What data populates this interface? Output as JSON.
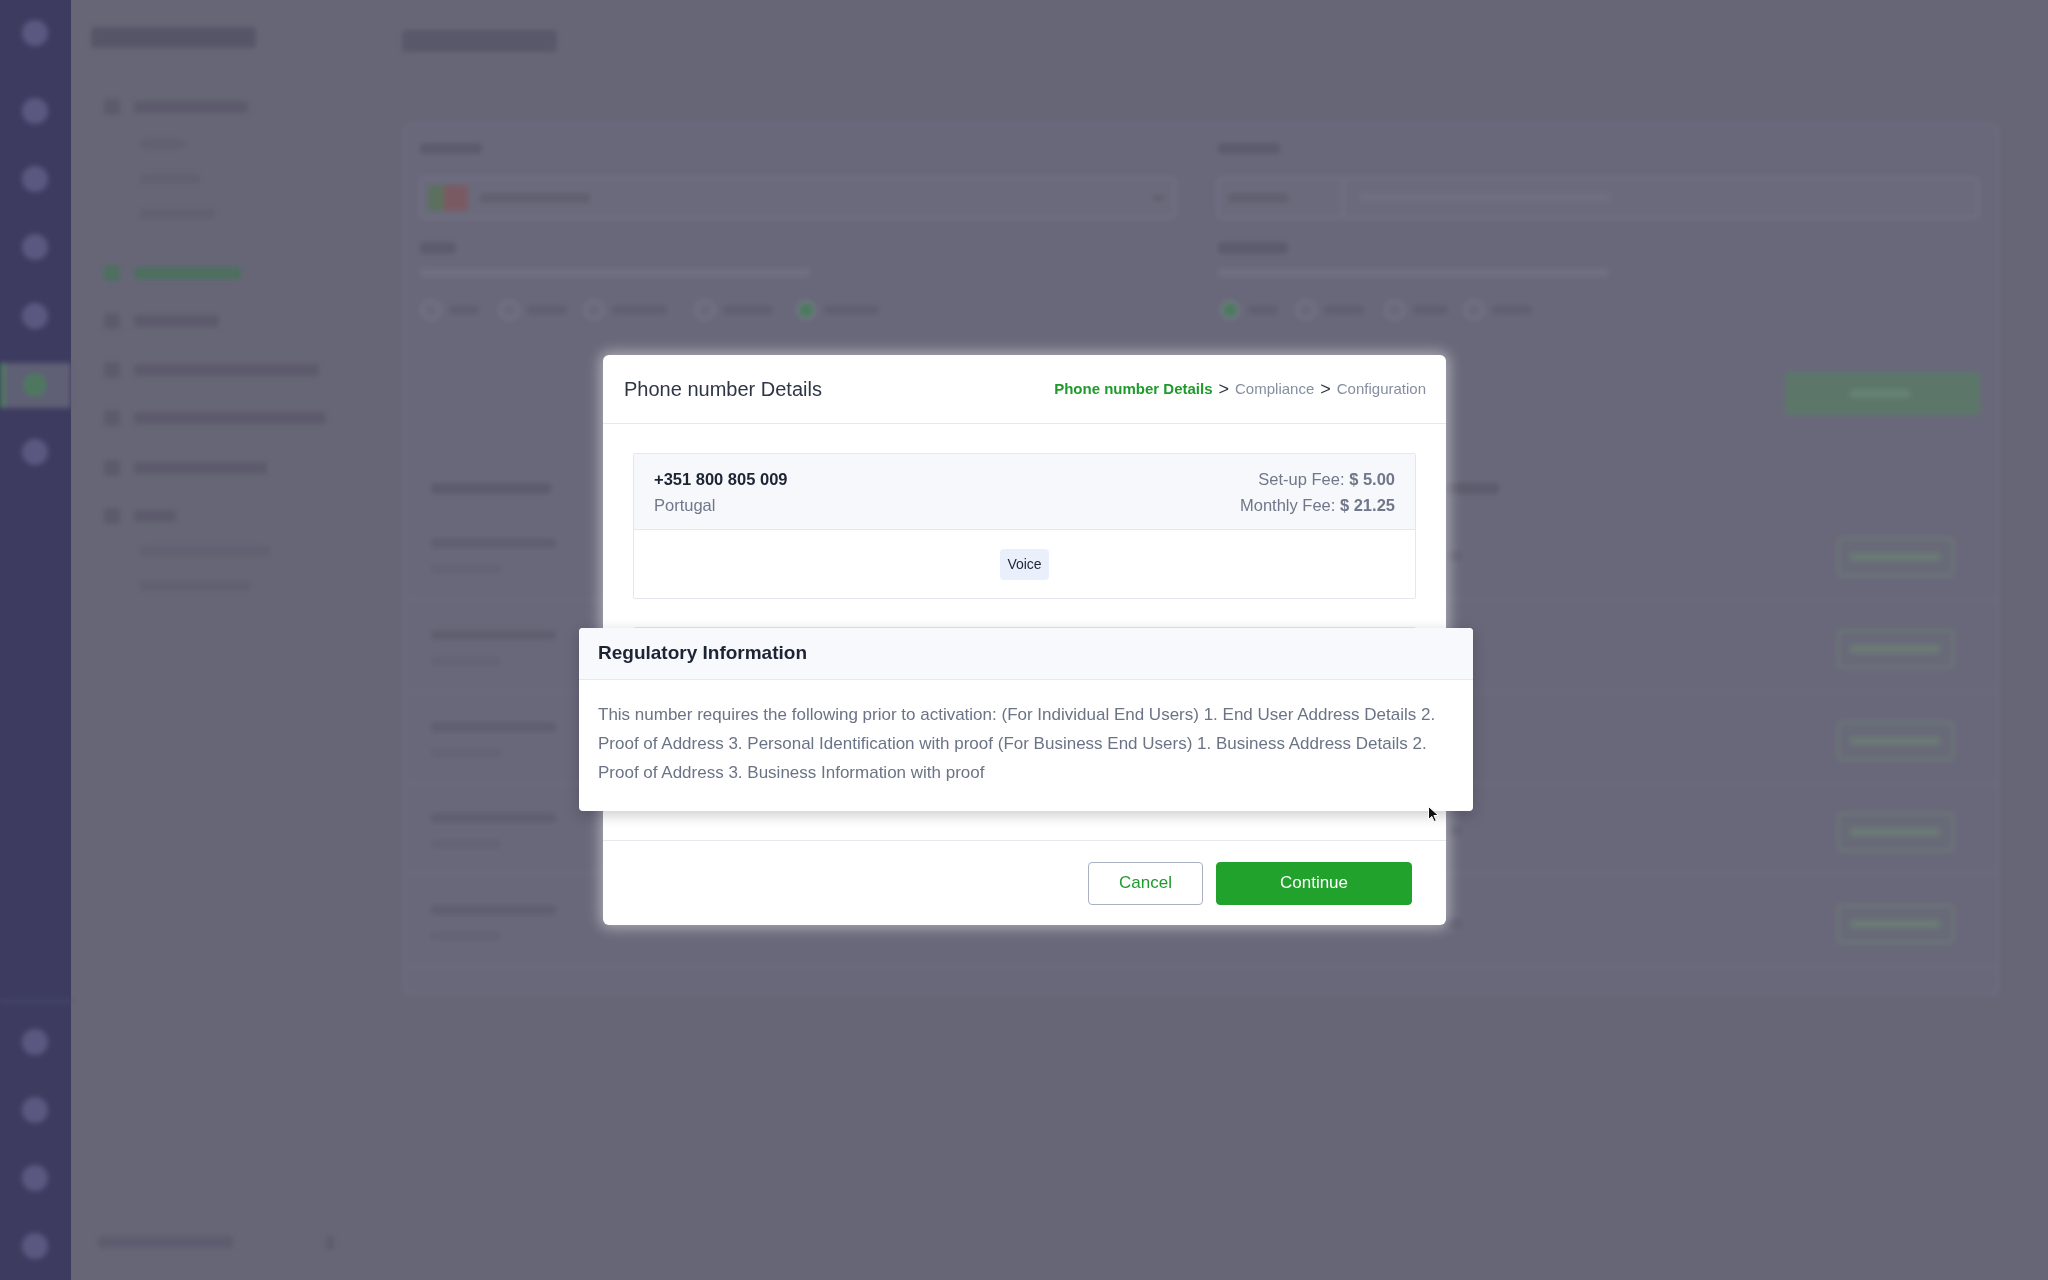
{
  "modal": {
    "title": "Phone number Details",
    "breadcrumb": {
      "steps": [
        {
          "label": "Phone number Details",
          "selected": true
        },
        {
          "label": "Compliance",
          "selected": false
        },
        {
          "label": "Configuration",
          "selected": false
        }
      ],
      "separators": [
        ">",
        ">"
      ]
    },
    "number_card": {
      "number": "+351 800 805 009",
      "country": "Portugal",
      "fees": [
        "Set-up Fee: **$ 5.00**",
        "Monthly Fee: **$ 21.25**"
      ],
      "capabilities": [
        "Voice"
      ]
    },
    "buttons": [
      {
        "label": "Cancel",
        "kind": "secondary"
      },
      {
        "label": "Continue",
        "kind": "primary"
      }
    ]
  },
  "regulatory_popup": {
    "title": "Regulatory Information",
    "text": "This number requires the following prior to activation: (For Individual End Users) 1. End User Address Details 2. Proof of Address 3. Personal Identification with proof (For Business End Users) 1. Business Address Details 2. Proof of Address 3. Business Information with proof"
  }
}
